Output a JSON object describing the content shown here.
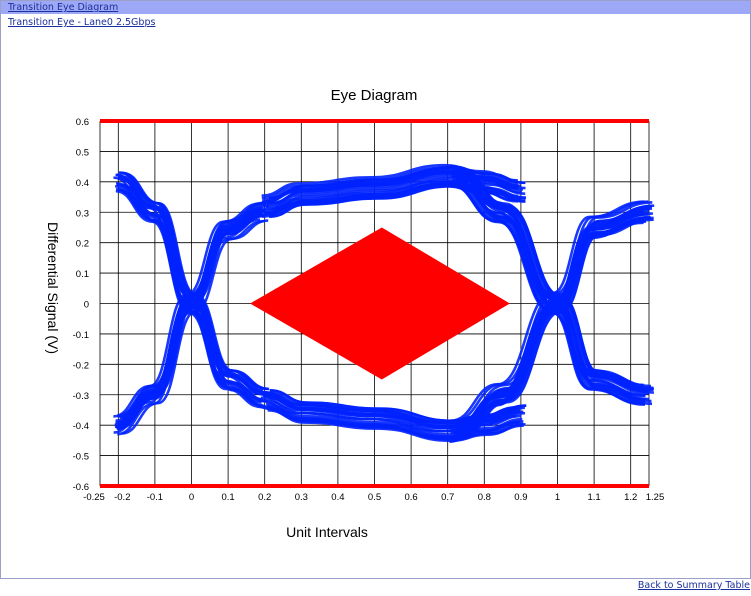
{
  "header": {
    "title_link": "Transition Eye Diagram",
    "subtitle_link": "Transition Eye - Lane0 2.5Gbps"
  },
  "footer": {
    "back_link": "Back to Summary Table"
  },
  "colors": {
    "header_bar": "#9da8f6",
    "link": "#1c2f9c",
    "trace": "#0022ff",
    "mask": "#ff0000",
    "limit_line": "#ff0000",
    "grid": "#000000"
  },
  "chart_data": {
    "type": "line",
    "title": "Eye Diagram",
    "xlabel": "Unit Intervals",
    "ylabel": "Differential Signal (V)",
    "xlim": [
      -0.25,
      1.25
    ],
    "ylim": [
      -0.6,
      0.6
    ],
    "x_ticks": [
      -0.25,
      -0.2,
      -0.1,
      0,
      0.1,
      0.2,
      0.3,
      0.4,
      0.5,
      0.6,
      0.7,
      0.8,
      0.9,
      1,
      1.1,
      1.2,
      1.25
    ],
    "x_tick_labels": [
      "-0.25",
      "-0.2",
      "-0.1",
      "0",
      "0.1",
      "0.2",
      "0.3",
      "0.4",
      "0.5",
      "0.6",
      "0.7",
      "0.8",
      "0.9",
      "1",
      "1.1",
      "1.2",
      "1.25"
    ],
    "y_ticks": [
      0.6,
      0.5,
      0.4,
      0.3,
      0.2,
      0.1,
      0,
      -0.1,
      -0.2,
      -0.3,
      -0.4,
      -0.5,
      -0.6
    ],
    "y_tick_labels": [
      "0.6",
      "0.5",
      "0.4",
      "0.3",
      "0.2",
      "0.1",
      "0",
      "-0.1",
      "-0.2",
      "-0.3",
      "-0.4",
      "-0.5",
      "-0.6"
    ],
    "grid": true,
    "limit_lines": [
      0.6,
      -0.6
    ],
    "eye_mask": [
      [
        0.16,
        0
      ],
      [
        0.52,
        0.25
      ],
      [
        0.87,
        0
      ],
      [
        0.52,
        -0.25
      ]
    ],
    "eye_traces": {
      "upper_left_crossing": [
        [
          -0.2,
          0.4
        ],
        [
          -0.1,
          0.3
        ],
        [
          0,
          0
        ],
        [
          0.1,
          -0.25
        ],
        [
          0.2,
          -0.31
        ]
      ],
      "lower_left_crossing": [
        [
          -0.2,
          -0.4
        ],
        [
          -0.1,
          -0.3
        ],
        [
          0,
          0
        ],
        [
          0.1,
          0.24
        ],
        [
          0.2,
          0.3
        ]
      ],
      "top_rail": [
        [
          0.2,
          0.32
        ],
        [
          0.3,
          0.36
        ],
        [
          0.5,
          0.38
        ],
        [
          0.7,
          0.42
        ],
        [
          0.8,
          0.4
        ],
        [
          0.9,
          0.37
        ]
      ],
      "bottom_rail": [
        [
          0.2,
          -0.32
        ],
        [
          0.3,
          -0.36
        ],
        [
          0.5,
          -0.38
        ],
        [
          0.7,
          -0.42
        ],
        [
          0.8,
          -0.4
        ],
        [
          0.9,
          -0.37
        ]
      ],
      "upper_right_crossing": [
        [
          0.72,
          0.42
        ],
        [
          0.85,
          0.3
        ],
        [
          1.0,
          0
        ],
        [
          1.1,
          -0.25
        ],
        [
          1.25,
          -0.3
        ]
      ],
      "lower_right_crossing": [
        [
          0.72,
          -0.42
        ],
        [
          0.85,
          -0.3
        ],
        [
          1.0,
          0
        ],
        [
          1.1,
          0.25
        ],
        [
          1.25,
          0.3
        ]
      ]
    }
  }
}
